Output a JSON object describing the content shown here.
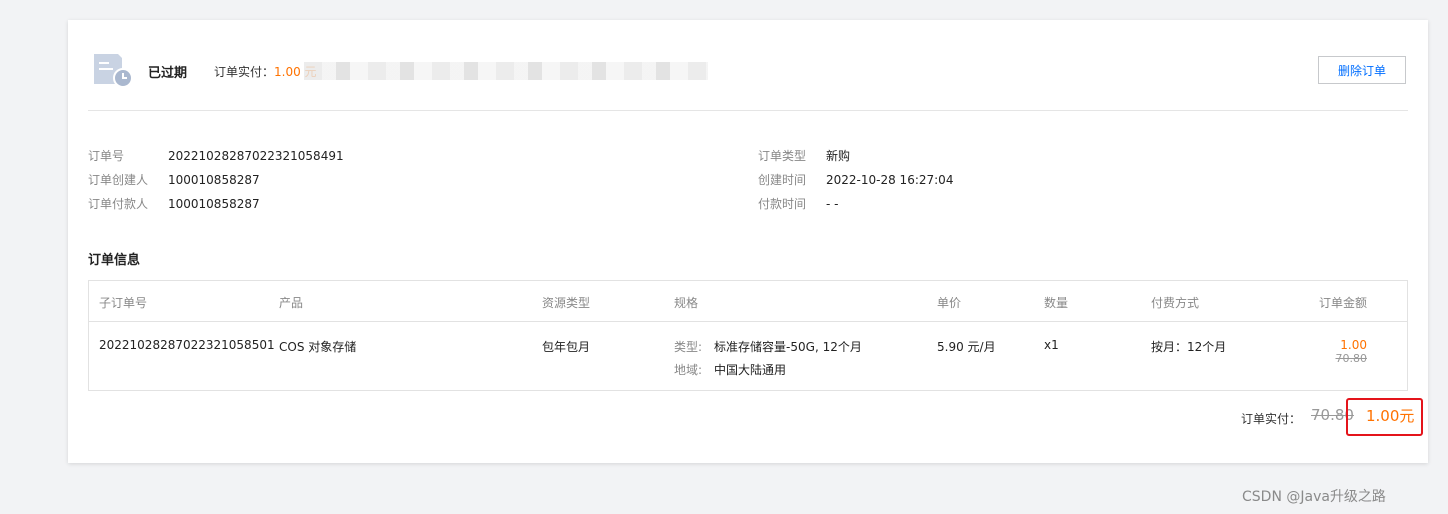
{
  "header": {
    "status": "已过期",
    "paid_label": "订单实付：",
    "paid_amount": "1.00 元",
    "delete_button": "删除订单"
  },
  "order_info": {
    "left": [
      {
        "label": "订单号",
        "value": "20221028287022321058491"
      },
      {
        "label": "订单创建人",
        "value": "100010858287"
      },
      {
        "label": "订单付款人",
        "value": "100010858287"
      }
    ],
    "right": [
      {
        "label": "订单类型",
        "value": "新购"
      },
      {
        "label": "创建时间",
        "value": "2022-10-28 16:27:04"
      },
      {
        "label": "付款时间",
        "value": "- -"
      }
    ]
  },
  "section_title": "订单信息",
  "table": {
    "headers": [
      "子订单号",
      "产品",
      "资源类型",
      "规格",
      "单价",
      "数量",
      "付费方式",
      "订单金额"
    ],
    "row": {
      "sub_order_id": "20221028287022321058501",
      "product": "COS 对象存储",
      "resource_type": "包年包月",
      "spec": [
        {
          "label": "类型:",
          "value": "标准存储容量-50G, 12个月"
        },
        {
          "label": "地域:",
          "value": "中国大陆通用"
        }
      ],
      "unit_price": "5.90 元/月",
      "quantity": "x1",
      "billing": "按月：12个月",
      "amount": "1.00",
      "original_amount": "70.80"
    }
  },
  "total": {
    "label": "订单实付：",
    "original": "70.80",
    "amount": "1.00元"
  },
  "watermark": "CSDN @Java升级之路",
  "colors": {
    "accent": "#006eff",
    "price": "#ff7200",
    "highlight": "#e4141b"
  }
}
